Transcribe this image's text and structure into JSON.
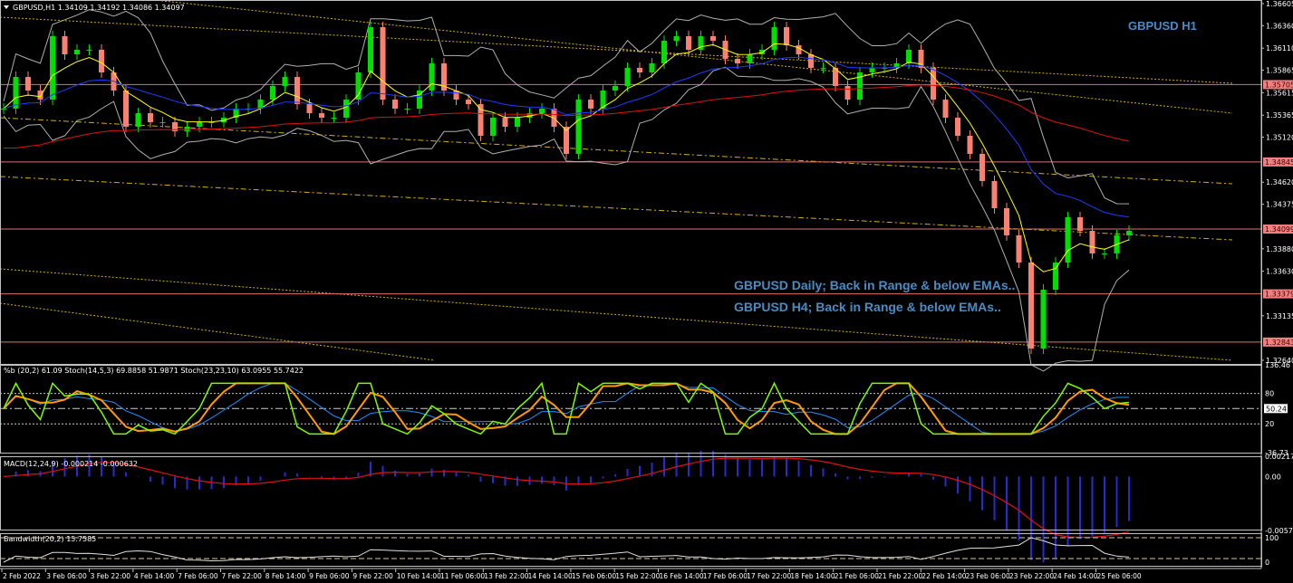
{
  "header": {
    "symbol_info": "GBPUSD,H1  1.34109 1.34192 1.34086 1.34097"
  },
  "chart_title": "GBPUSD H1",
  "annotations": [
    "GBPUSD Daily; Back in Range & below EMAs..",
    "GBPUSD H4; Back in Range & below EMAs.."
  ],
  "colors": {
    "background": "#000000",
    "bull": "#00e000",
    "bear": "#fa8072",
    "level_line": "#e07070",
    "label_bg": "#f08080",
    "axis": "#c0c0c0",
    "title": "#4a8bc4",
    "ema_fast": "#ffff00",
    "ema_mid": "#1e3cff",
    "ema_slow": "#e01010",
    "bands": "#b0b0b0",
    "trendline": "#d4b000"
  },
  "chart_data": {
    "type": "candlestick",
    "price_axis": {
      "range": [
        1.3264,
        1.36605
      ],
      "ticks": [
        "1.36605",
        "1.36360",
        "1.36110",
        "1.35865",
        "1.35615",
        "1.35365",
        "1.35120",
        "1.34620",
        "1.34375",
        "1.33880",
        "1.33630",
        "1.33135",
        "1.32640"
      ]
    },
    "levels": [
      "1.35705",
      "1.34845",
      "1.34099",
      "1.33379",
      "1.32843"
    ],
    "close": [
      1.35438,
      1.3579,
      1.35639,
      1.35538,
      1.36243,
      1.36041,
      1.36092,
      1.36092,
      1.3584,
      1.35639,
      1.35236,
      1.35387,
      1.35287,
      1.35287,
      1.35186,
      1.35236,
      1.35287,
      1.35287,
      1.35337,
      1.35438,
      1.35438,
      1.35538,
      1.35689,
      1.3579,
      1.35488,
      1.35387,
      1.35337,
      1.35337,
      1.35538,
      1.3584,
      1.36343,
      1.35538,
      1.35438,
      1.35438,
      1.35639,
      1.35941,
      1.35639,
      1.35538,
      1.35488,
      1.35136,
      1.35337,
      1.35236,
      1.35337,
      1.35387,
      1.35438,
      1.35236,
      1.34935,
      1.35538,
      1.35438,
      1.35639,
      1.35689,
      1.35891,
      1.3584,
      1.35941,
      1.36192,
      1.36243,
      1.36092,
      1.36243,
      1.36192,
      1.35991,
      1.35941,
      1.36041,
      1.36092,
      1.36343,
      1.36142,
      1.36041,
      1.35891,
      1.35891,
      1.35689,
      1.35538,
      1.3584,
      1.35891,
      1.35891,
      1.35941,
      1.36092,
      1.35891,
      1.35538,
      1.35337,
      1.35136,
      1.34935,
      1.34633,
      1.34331,
      1.34029,
      1.33727,
      1.32771,
      1.33425,
      1.33727,
      1.3423,
      1.34079,
      1.33828,
      1.33828,
      1.34029,
      1.34079
    ],
    "x_ticks": [
      "2 Feb 2022",
      "3 Feb 06:00",
      "3 Feb 22:00",
      "4 Feb 14:00",
      "7 Feb 06:00",
      "7 Feb 22:00",
      "8 Feb 14:00",
      "9 Feb 06:00",
      "9 Feb 22:00",
      "10 Feb 14:00",
      "11 Feb 06:00",
      "13 Feb 22:00",
      "14 Feb 14:00",
      "15 Feb 06:00",
      "15 Feb 22:00",
      "16 Feb 14:00",
      "17 Feb 06:00",
      "17 Feb 22:00",
      "18 Feb 14:00",
      "21 Feb 06:00",
      "21 Feb 22:00",
      "22 Feb 14:00",
      "23 Feb 06:00",
      "23 Feb 22:00",
      "24 Feb 14:00",
      "25 Feb 06:00"
    ],
    "indicators": {
      "stoch": {
        "label": "%b (20,2) 61.09  Stoch(14,5,3) 69.8858 51.9871  Stoch(23,23,10) 63.0955 55.7422",
        "range": [
          -36.73,
          136.46
        ],
        "ticks": [
          "136.46",
          "80",
          "20",
          "-36.73"
        ],
        "current": "50.24"
      },
      "macd": {
        "label": "MACD(12,24,9) -0.000214 -0.000632",
        "range": [
          -0.005794,
          0.002176
        ],
        "ticks": [
          "0.002176",
          "0.00",
          "-0.005794"
        ]
      },
      "bandwidth": {
        "label": "Bandwidth(20,2) 15.7585",
        "range": [
          0,
          100
        ],
        "ticks": [
          "100",
          "0"
        ]
      }
    }
  }
}
